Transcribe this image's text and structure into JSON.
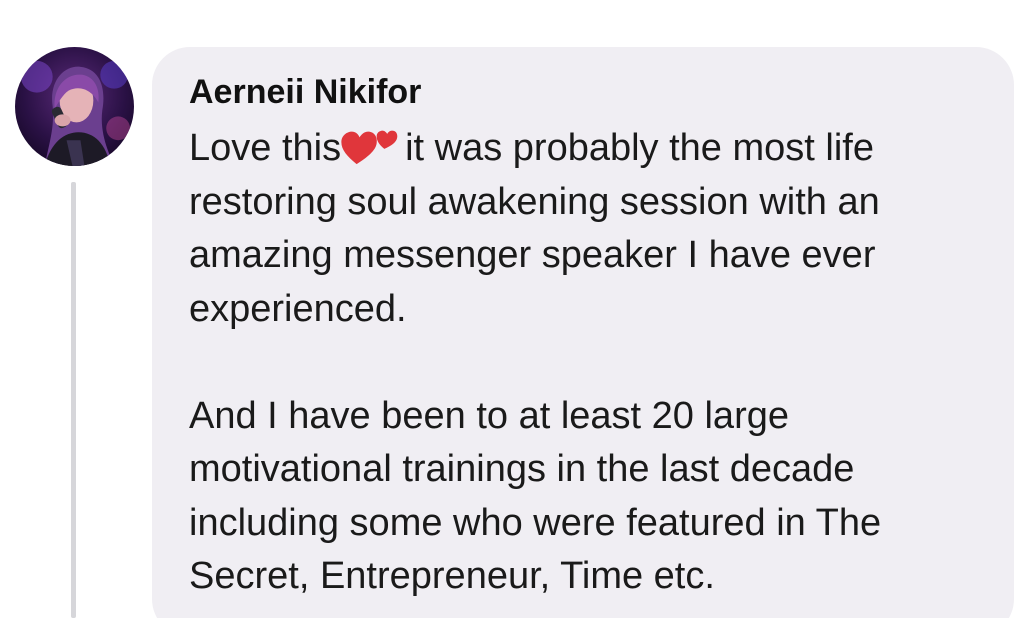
{
  "comment": {
    "author": "Aerneii Nikifor",
    "line1_before": "Love this",
    "heart_icon": "two-hearts-icon",
    "line1_after": "it was probably the most life",
    "line2": "restoring soul awakening session with an",
    "line3": "amazing messenger speaker I have ever",
    "line4": "experienced.",
    "line5": "And I have been to at least 20 large",
    "line6": "motivational trainings in the last decade",
    "line7": "including some who were featured in The",
    "line8": "Secret, Entrepreneur, Time etc."
  },
  "colors": {
    "bubble": "#f0eef3",
    "thread_line": "#d6d6da",
    "heart": "#e0363b"
  }
}
